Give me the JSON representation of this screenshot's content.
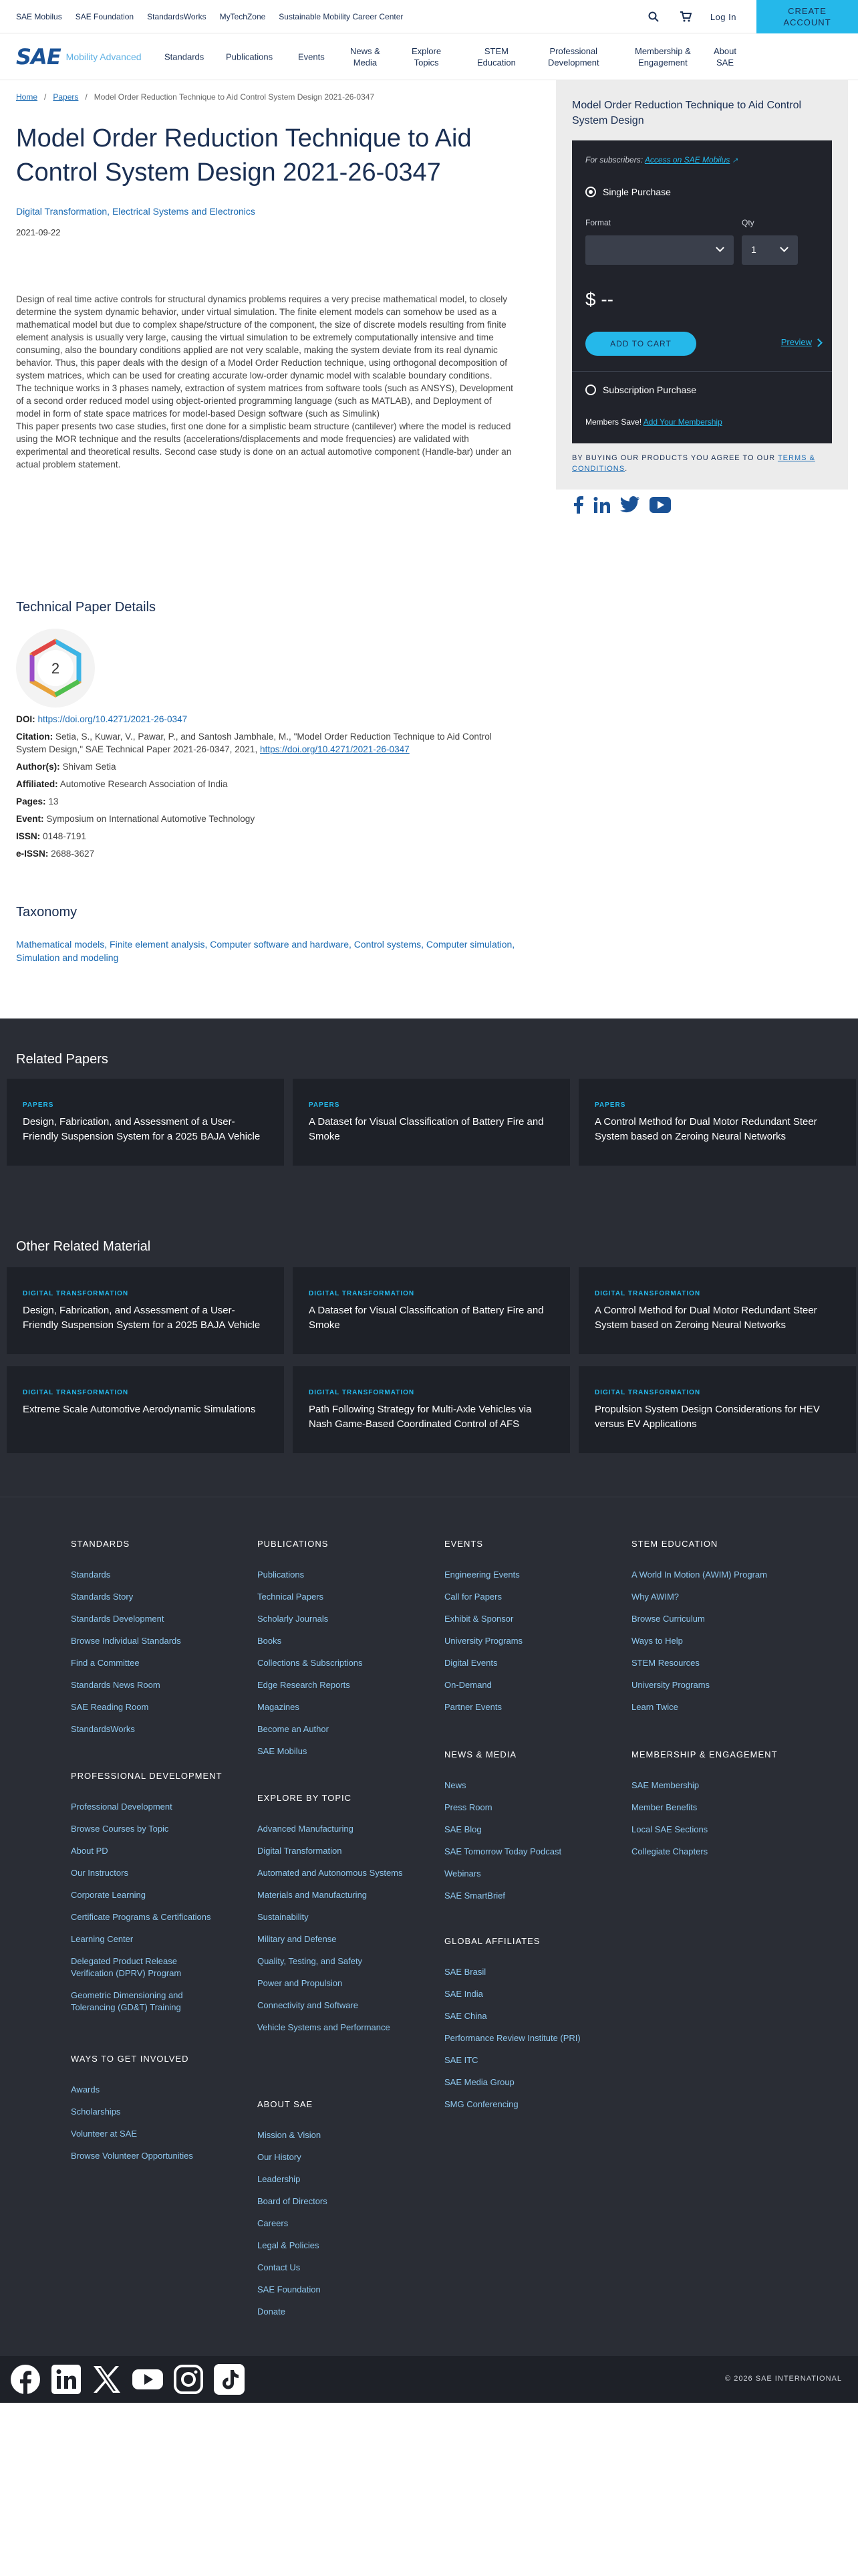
{
  "topbar": {
    "links": [
      "SAE Mobilus",
      "SAE Foundation",
      "StandardsWorks",
      "MyTechZone",
      "Sustainable Mobility Career Center"
    ],
    "login": "Log In",
    "create_line1": "CREATE",
    "create_line2": "ACCOUNT"
  },
  "nav": {
    "logo_text": "SAE",
    "logo_sub": "Mobility Advanced",
    "items": [
      "Standards",
      "Publications",
      "Events",
      "News &\nMedia",
      "Explore\nTopics",
      "STEM\nEducation",
      "Professional\nDevelopment",
      "Membership &\nEngagement",
      "About\nSAE"
    ]
  },
  "breadcrumb": {
    "home": "Home",
    "papers": "Papers",
    "current": "Model Order Reduction Technique to Aid Control System Design 2021-26-0347"
  },
  "paper": {
    "title": "Model Order Reduction Technique to Aid Control System Design 2021-26-0347",
    "topics": "Digital Transformation, Electrical Systems and Electronics",
    "date": "2021-09-22",
    "abstract": [
      "Design of real time active controls for structural dynamics problems requires a very precise mathematical model, to closely determine the system dynamic behavior, under virtual simulation. The finite element models can somehow be used as a mathematical model but due to complex shape/structure of the component, the size of discrete models resulting from finite element analysis is usually very large, causing the virtual simulation to be extremely computationally intensive and time consuming, also the boundary conditions applied are not very scalable, making the system deviate from its real dynamic behavior. Thus, this paper deals with the design of a Model Order Reduction technique, using orthogonal decomposition of system matrices, which can be used for creating accurate low-order dynamic model with scalable boundary conditions.",
      "The technique works in 3 phases namely, extraction of system matrices from software tools (such as ANSYS), Development of a second order reduced model using object-oriented programming language (such as MATLAB), and Deployment of model in form of state space matrices for model-based Design software (such as Simulink)",
      "This paper presents two case studies, first one done for a simplistic beam structure (cantilever) where the model is reduced using the MOR technique and the results (accelerations/displacements and mode frequencies) are validated with experimental and theoretical results. Second case study is done on an actual automotive component (Handle-bar) under an actual problem statement."
    ]
  },
  "details": {
    "heading": "Technical Paper Details",
    "badge_value": "2",
    "doi_label": "DOI:",
    "doi": "https://doi.org/10.4271/2021-26-0347",
    "citation_label": "Citation:",
    "citation": "Setia, S., Kuwar, V., Pawar, P., and Santosh Jambhale, M., \"Model Order Reduction Technique to Aid Control System Design,\" SAE Technical Paper 2021-26-0347, 2021,",
    "citation_link": "https://doi.org/10.4271/2021-26-0347",
    "authors_label": "Author(s):",
    "authors": "Shivam Setia",
    "affiliated_label": "Affiliated:",
    "affiliated": "Automotive Research Association of India",
    "pages_label": "Pages:",
    "pages": "13",
    "event_label": "Event:",
    "event": "Symposium on International Automotive Technology",
    "issn_label": "ISSN:",
    "issn": "0148-7191",
    "eissn_label": "e-ISSN:",
    "eissn": "2688-3627"
  },
  "taxonomy": {
    "heading": "Taxonomy",
    "text": "Mathematical models, Finite element analysis, Computer software and hardware, Control systems, Computer simulation, Simulation and modeling"
  },
  "purchase": {
    "title": "Model Order Reduction Technique to Aid Control System Design",
    "subscribers": "For subscribers:",
    "access_link": "Access on SAE Mobilus",
    "single": "Single Purchase",
    "format_label": "Format",
    "qty_label": "Qty",
    "qty_value": "1",
    "price": "$ --",
    "add_to_cart": "ADD TO CART",
    "preview": "Preview",
    "subscription": "Subscription Purchase",
    "members_save": "Members Save!",
    "add_membership": "Add Your Membership",
    "agree_text": "BY BUYING OUR PRODUCTS YOU AGREE TO OUR",
    "terms": "TERMS & CONDITIONS",
    "agree_end": "."
  },
  "related_papers": {
    "heading": "Related Papers",
    "items": [
      {
        "kind": "PAPERS",
        "title": "Design, Fabrication, and Assessment of a User-Friendly Suspension System for a 2025 BAJA Vehicle"
      },
      {
        "kind": "PAPERS",
        "title": "A Dataset for Visual Classification of Battery Fire and Smoke"
      },
      {
        "kind": "PAPERS",
        "title": "A Control Method for Dual Motor Redundant Steer System based on Zeroing Neural Networks"
      }
    ]
  },
  "other_material": {
    "heading": "Other Related Material",
    "items": [
      {
        "kind": "DIGITAL TRANSFORMATION",
        "title": "Design, Fabrication, and Assessment of a User-Friendly Suspension System for a 2025 BAJA Vehicle"
      },
      {
        "kind": "DIGITAL TRANSFORMATION",
        "title": "A Dataset for Visual Classification of Battery Fire and Smoke"
      },
      {
        "kind": "DIGITAL TRANSFORMATION",
        "title": "A Control Method for Dual Motor Redundant Steer System based on Zeroing Neural Networks"
      },
      {
        "kind": "DIGITAL TRANSFORMATION",
        "title": "Extreme Scale Automotive Aerodynamic Simulations"
      },
      {
        "kind": "DIGITAL TRANSFORMATION",
        "title": "Path Following Strategy for Multi-Axle Vehicles via Nash Game-Based Coordinated Control of AFS"
      },
      {
        "kind": "DIGITAL TRANSFORMATION",
        "title": "Propulsion System Design Considerations for HEV versus EV Applications"
      }
    ]
  },
  "footer": {
    "standards": {
      "heading": "STANDARDS",
      "items": [
        "Standards",
        "Standards Story",
        "Standards Development",
        "Browse Individual Standards",
        "Find a Committee",
        "Standards News Room",
        "SAE Reading Room",
        "StandardsWorks"
      ]
    },
    "publications": {
      "heading": "PUBLICATIONS",
      "items": [
        "Publications",
        "Technical Papers",
        "Scholarly Journals",
        "Books",
        "Collections & Subscriptions",
        "Edge Research Reports",
        "Magazines",
        "Become an Author",
        "SAE Mobilus"
      ]
    },
    "events": {
      "heading": "EVENTS",
      "items": [
        "Engineering Events",
        "Call for Papers",
        "Exhibit & Sponsor",
        "University Programs",
        "Digital Events",
        "On-Demand",
        "Partner Events"
      ]
    },
    "stem": {
      "heading": "STEM EDUCATION",
      "items": [
        "A World In Motion (AWIM) Program",
        "Why AWIM?",
        "Browse Curriculum",
        "Ways to Help",
        "STEM Resources",
        "University Programs",
        "Learn Twice"
      ]
    },
    "pd": {
      "heading": "PROFESSIONAL DEVELOPMENT",
      "items": [
        "Professional Development",
        "Browse Courses by Topic",
        "About PD",
        "Our Instructors",
        "Corporate Learning",
        "Certificate Programs & Certifications",
        "Learning Center",
        "Delegated Product Release Verification (DPRV) Program",
        "Geometric Dimensioning and Tolerancing (GD&T) Training"
      ]
    },
    "explore": {
      "heading": "EXPLORE BY TOPIC",
      "items": [
        "Advanced Manufacturing",
        "Digital Transformation",
        "Automated and Autonomous Systems",
        "Materials and Manufacturing",
        "Sustainability",
        "Military and Defense",
        "Quality, Testing, and Safety",
        "Power and Propulsion",
        "Connectivity and Software",
        "Vehicle Systems and Performance"
      ]
    },
    "news": {
      "heading": "NEWS & MEDIA",
      "items": [
        "News",
        "Press Room",
        "SAE Blog",
        "SAE Tomorrow Today Podcast",
        "Webinars",
        "SAE SmartBrief"
      ]
    },
    "membership": {
      "heading": "MEMBERSHIP & ENGAGEMENT",
      "items": [
        "SAE Membership",
        "Member Benefits",
        "Local SAE Sections",
        "Collegiate Chapters"
      ]
    },
    "affiliates": {
      "heading": "GLOBAL AFFILIATES",
      "items": [
        "SAE Brasil",
        "SAE India",
        "SAE China",
        "Performance Review Institute (PRI)",
        "SAE ITC",
        "SAE Media Group",
        "SMG Conferencing"
      ]
    },
    "involved": {
      "heading": "WAYS TO GET INVOLVED",
      "items": [
        "Awards",
        "Scholarships",
        "Volunteer at SAE",
        "Browse Volunteer Opportunities"
      ]
    },
    "about": {
      "heading": "ABOUT SAE",
      "items": [
        "Mission & Vision",
        "Our History",
        "Leadership",
        "Board of Directors",
        "Careers",
        "Legal & Policies",
        "Contact Us",
        "SAE Foundation",
        "Donate"
      ]
    }
  },
  "copyright": "© 2026 SAE INTERNATIONAL",
  "colors": {
    "brand_navy": "#1a2f53",
    "accent": "#25b8ea",
    "link": "#1a6ab2",
    "dark_bg": "#2a2d35"
  }
}
